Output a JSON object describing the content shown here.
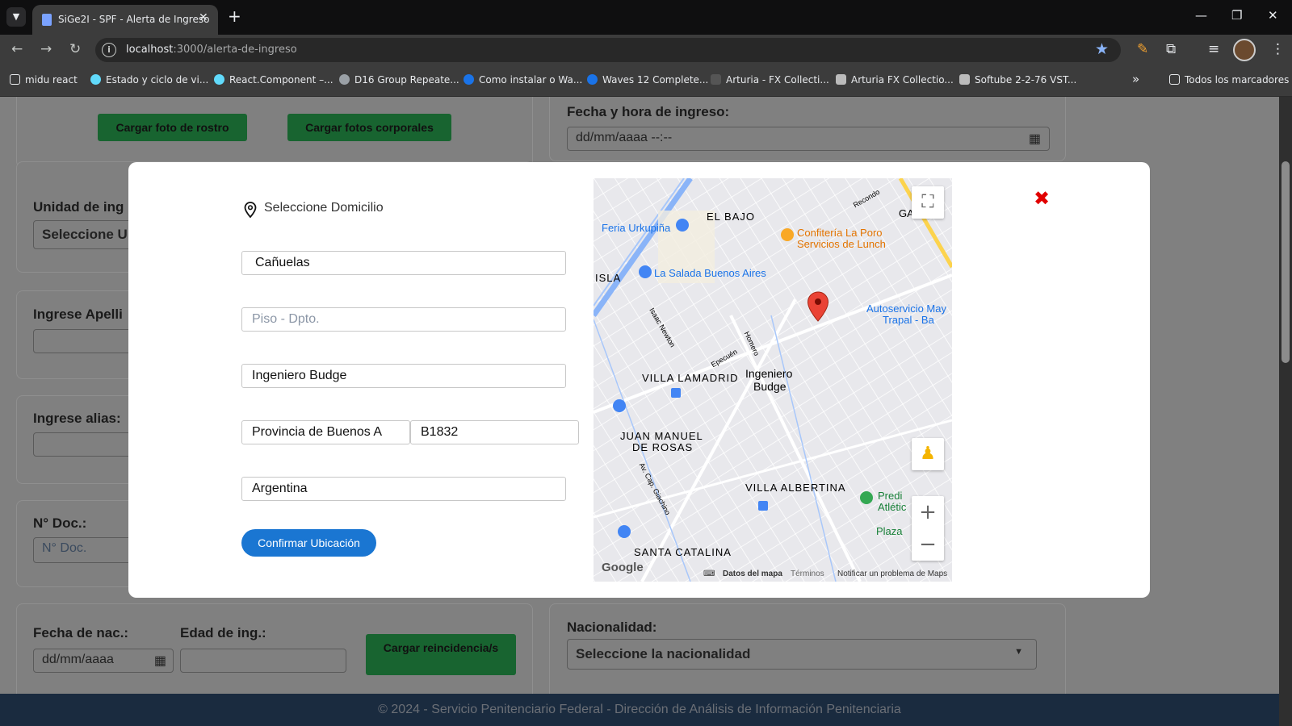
{
  "browser": {
    "tab_title": "SiGe2I - SPF - Alerta de Ingreso",
    "tab_close": "✕",
    "new_tab": "+",
    "url_host": "localhost",
    "url_path": ":3000/alerta-de-ingreso",
    "bookmarks": [
      {
        "label": "midu react",
        "color": "#e8eaed"
      },
      {
        "label": "Estado y ciclo de vi...",
        "color": "#61dafb"
      },
      {
        "label": "React.Component –...",
        "color": "#61dafb"
      },
      {
        "label": "D16 Group Repeate...",
        "color": "#9aa0a6"
      },
      {
        "label": "Como instalar o Wa...",
        "color": "#1a73e8"
      },
      {
        "label": "Waves 12 Complete...",
        "color": "#1a73e8"
      },
      {
        "label": "Arturia - FX Collecti...",
        "color": "#e8eaed"
      },
      {
        "label": "Arturia FX Collectio...",
        "color": "#e8eaed"
      },
      {
        "label": "Softube 2-2-76 VST...",
        "color": "#e8eaed"
      }
    ],
    "bookmarks_overflow": "»",
    "all_bookmarks": "Todos los marcadores"
  },
  "form": {
    "btn_face_photo": "Cargar foto de rostro",
    "btn_body_photos": "Cargar fotos corporales",
    "entry_datetime_label": "Fecha y hora de ingreso:",
    "entry_datetime_placeholder": "dd/mm/aaaa --:--",
    "unit_label": "Unidad de ing",
    "unit_select": "Seleccione U",
    "surname_label": "Ingrese Apelli",
    "alias_label": "Ingrese alias:",
    "doc_label": "N° Doc.:",
    "doc_placeholder": "N° Doc.",
    "birth_label": "Fecha de nac.:",
    "birth_placeholder": "dd/mm/aaaa",
    "age_label": "Edad de ing.:",
    "btn_recidivism": "Cargar reincidencia/s",
    "nationality_label": "Nacionalidad:",
    "nationality_select": "Seleccione la nacionalidad"
  },
  "footer": "© 2024 - Servicio Penitenciario Federal - Dirección de Análisis de Información Penitenciaria",
  "modal": {
    "title": "Seleccione Domicilio",
    "street": "Cañuelas",
    "floor_placeholder": "Piso - Dpto.",
    "locality": "Ingeniero Budge",
    "province": "Provincia de Buenos A",
    "postal_code": "B1832",
    "country": "Argentina",
    "confirm": "Confirmar Ubicación",
    "close": "✖"
  },
  "map": {
    "labels": [
      {
        "text": "EL BAJO",
        "color": "#333"
      },
      {
        "text": "Feria Urkupiña",
        "color": "#1a73e8"
      },
      {
        "text": "Confitería La Poro",
        "color": "#e37400"
      },
      {
        "text": "Servicios de Lunch",
        "color": "#e37400"
      },
      {
        "text": "La Salada Buenos Aires",
        "color": "#1a73e8"
      },
      {
        "text": "Autoservicio May",
        "color": "#1a73e8"
      },
      {
        "text": "Trapal - Ba",
        "color": "#1a73e8"
      },
      {
        "text": "VILLA LAMADRID",
        "color": "#333"
      },
      {
        "text": "Ingeniero",
        "color": "#222"
      },
      {
        "text": "Budge",
        "color": "#222"
      },
      {
        "text": "JUAN MANUEL",
        "color": "#333"
      },
      {
        "text": "DE ROSAS",
        "color": "#333"
      },
      {
        "text": "VILLA ALBERTINA",
        "color": "#333"
      },
      {
        "text": "Predi",
        "color": "#188038"
      },
      {
        "text": "Atlétic",
        "color": "#188038"
      },
      {
        "text": "Plaza",
        "color": "#188038"
      },
      {
        "text": "SANTA CATALINA",
        "color": "#333"
      },
      {
        "text": "ISLA",
        "color": "#333"
      },
      {
        "text": "Recondo",
        "color": "#555"
      },
      {
        "text": "Isaac Newton",
        "color": "#555"
      },
      {
        "text": "Homero",
        "color": "#555"
      },
      {
        "text": "Epecuén",
        "color": "#555"
      },
      {
        "text": "Av. Cap. Giachino",
        "color": "#555"
      },
      {
        "text": "GA",
        "color": "#333"
      }
    ],
    "google": "Google",
    "map_data": "Datos del mapa",
    "terms": "Términos",
    "report": "Notificar un problema de Maps",
    "zoom_in": "+",
    "zoom_out": "−",
    "fullscreen": "⛶"
  }
}
